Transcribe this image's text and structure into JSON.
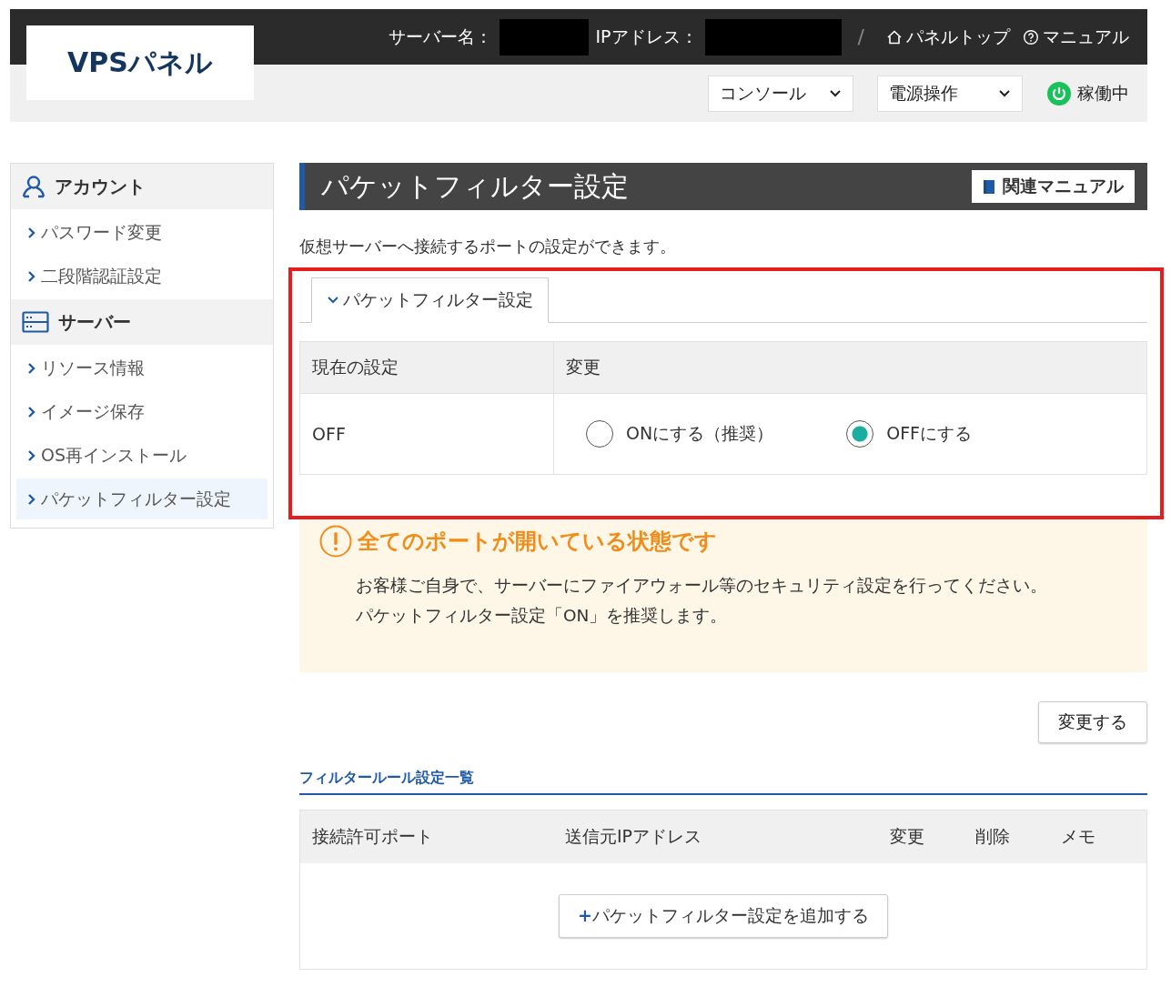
{
  "header": {
    "logo": "VPSパネル",
    "server_label": "サーバー名：",
    "ip_label": "IPアドレス：",
    "separator": "/",
    "links": [
      {
        "kind": "home",
        "label": "パネルトップ"
      },
      {
        "kind": "help",
        "label": "マニュアル"
      }
    ],
    "dropdowns": [
      "コンソール",
      "電源操作"
    ],
    "status": {
      "label": "稼働中",
      "on": true
    }
  },
  "sidebar": {
    "sections": [
      {
        "kind": "account",
        "title": "アカウント",
        "items": [
          {
            "label": "パスワード変更",
            "selected": false
          },
          {
            "label": "二段階認証設定",
            "selected": false
          }
        ]
      },
      {
        "kind": "server",
        "title": "サーバー",
        "items": [
          {
            "label": "リソース情報",
            "selected": false
          },
          {
            "label": "イメージ保存",
            "selected": false
          },
          {
            "label": "OS再インストール",
            "selected": false
          },
          {
            "label": "パケットフィルター設定",
            "selected": true
          }
        ]
      }
    ]
  },
  "page": {
    "title": "パケットフィルター設定",
    "manual_button": "関連マニュアル",
    "description": "仮想サーバーへ接続するポートの設定ができます。",
    "tab": {
      "label": "パケットフィルター設定",
      "expanded": true
    },
    "settings_table": {
      "columns": [
        "現在の設定",
        "変更"
      ],
      "current": "OFF",
      "options": [
        {
          "label": "ONにする（推奨）",
          "selected": false
        },
        {
          "label": "OFFにする",
          "selected": true
        }
      ]
    },
    "warning": {
      "title": "全てのポートが開いている状態です",
      "lines": [
        "お客様ご自身で、サーバーにファイアウォール等のセキュリティ設定を行ってください。",
        "パケットフィルター設定「ON」を推奨します。"
      ]
    },
    "apply_button": "変更する",
    "rules": {
      "heading": "フィルタールール設定一覧",
      "columns": [
        "接続許可ポート",
        "送信元IPアドレス",
        "変更",
        "削除",
        "メモ"
      ],
      "add_button": {
        "plus": "+",
        "label": "パケットフィルター設定を追加する"
      }
    }
  }
}
